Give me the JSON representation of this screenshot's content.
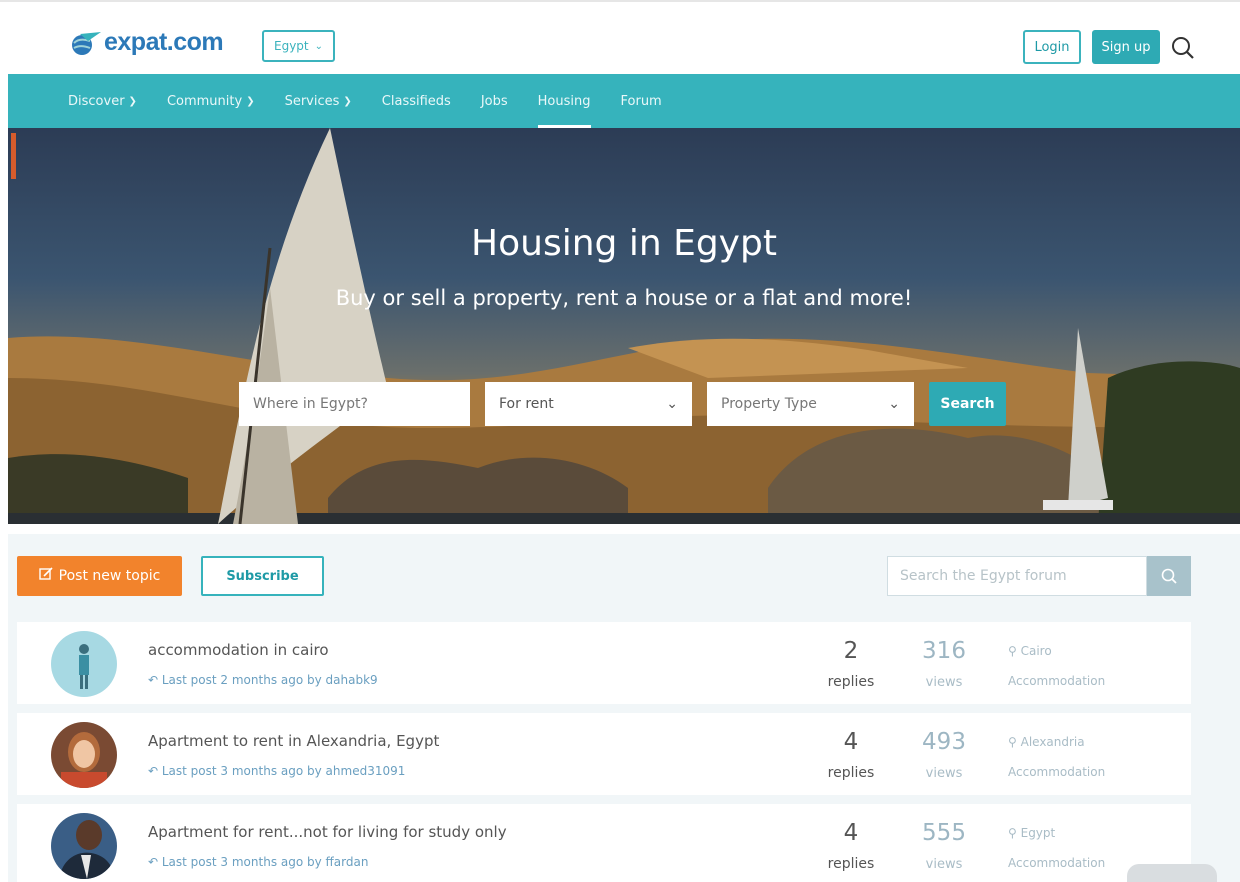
{
  "header": {
    "logo_text": "expat.com",
    "country": "Egypt",
    "login_label": "Login",
    "signup_label": "Sign up",
    "search_icon": "search-icon"
  },
  "nav": {
    "items": [
      {
        "label": "Discover",
        "dropdown": true
      },
      {
        "label": "Community",
        "dropdown": true
      },
      {
        "label": "Services",
        "dropdown": true
      },
      {
        "label": "Classifieds",
        "dropdown": false
      },
      {
        "label": "Jobs",
        "dropdown": false
      },
      {
        "label": "Housing",
        "dropdown": false,
        "active": true
      },
      {
        "label": "Forum",
        "dropdown": false
      }
    ]
  },
  "hero": {
    "title": "Housing in Egypt",
    "subtitle": "Buy or sell a property, rent a house or a flat and more!",
    "location_placeholder": "Where in Egypt?",
    "offer_type": "For rent",
    "property_type": "Property Type",
    "search_label": "Search"
  },
  "forum": {
    "post_label": "Post new topic",
    "subscribe_label": "Subscribe",
    "search_placeholder": "Search the Egypt forum",
    "topics": [
      {
        "title": "accommodation in cairo",
        "meta": "Last post 2 months ago by dahabk9",
        "replies": "2",
        "replies_label": "replies",
        "views": "316",
        "views_label": "views",
        "location": "Cairo",
        "category": "Accommodation"
      },
      {
        "title": "Apartment to rent in Alexandria, Egypt",
        "meta": "Last post 3 months ago by ahmed31091",
        "replies": "4",
        "replies_label": "replies",
        "views": "493",
        "views_label": "views",
        "location": "Alexandria",
        "category": "Accommodation"
      },
      {
        "title": "Apartment for rent...not for living for study only",
        "meta": "Last post 3 months ago by ffardan",
        "replies": "4",
        "replies_label": "replies",
        "views": "555",
        "views_label": "views",
        "location": "Egypt",
        "category": "Accommodation"
      }
    ]
  },
  "colors": {
    "teal": "#36b3bc",
    "orange": "#f2832c",
    "brand_blue": "#2c79b8"
  }
}
